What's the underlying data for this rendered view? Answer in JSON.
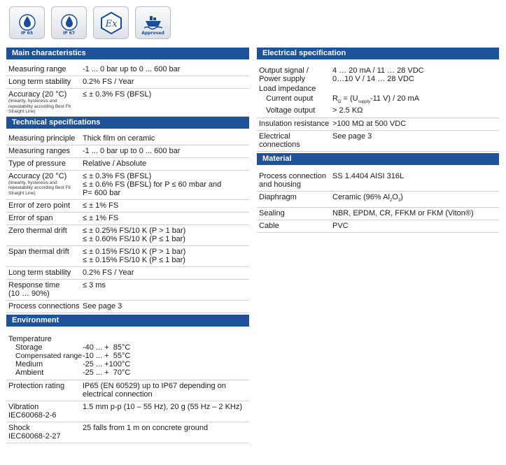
{
  "badges": [
    {
      "label": "IP 65",
      "icon": "water-drop-icon"
    },
    {
      "label": "IP 67",
      "icon": "water-drop-icon"
    },
    {
      "label": "Ex",
      "icon": "ex-hexagon-icon"
    },
    {
      "label": "Approved",
      "icon": "ship-icon"
    }
  ],
  "main_characteristics": {
    "title": "Main characteristics",
    "rows": [
      {
        "label": "Measuring range",
        "value": "-1 ... 0 bar up to 0 ... 600 bar"
      },
      {
        "label": "Long term stability",
        "value": "0.2% FS / Year"
      },
      {
        "label": "Accuracy (20 °C)",
        "note": "(linearity, hysteresis and repeatability according Best Fit Straight Line)",
        "value": "≤ ± 0.3% FS (BFSL)"
      }
    ]
  },
  "technical_specifications": {
    "title": "Technical specifications",
    "rows": [
      {
        "label": "Measuring principle",
        "value": "Thick film on ceramic"
      },
      {
        "label": "Measuring ranges",
        "value": "-1 ... 0 bar up to 0 ... 600 bar"
      },
      {
        "label": "Type of pressure",
        "value": "Relative / Absolute"
      },
      {
        "label": "Accuracy (20 °C)",
        "note": "(linearity, hysteresis and repeatability according Best Fit Straight Line)",
        "value_lines": [
          "≤ ± 0.3% FS (BFSL)",
          "≤ ± 0.6% FS (BFSL) for P ≤ 60 mbar and",
          "P= 600 bar"
        ]
      },
      {
        "label": "Error of zero point",
        "value": "≤ ± 1% FS"
      },
      {
        "label": "Error of span",
        "value": "≤ ± 1% FS"
      },
      {
        "label": "Zero thermal drift",
        "value_lines": [
          "≤ ± 0.25% FS/10 K (P > 1 bar)",
          "≤ ± 0.60% FS/10 K (P ≤ 1 bar)"
        ]
      },
      {
        "label": "Span thermal drift",
        "value_lines": [
          "≤ ± 0.15% FS/10 K (P > 1 bar)",
          "≤ ± 0.15% FS/10 K (P ≤ 1 bar)"
        ]
      },
      {
        "label": "Long term stability",
        "value": "0.2% FS / Year"
      },
      {
        "label_lines": [
          "Response time",
          "(10 … 90%)"
        ],
        "value": "≤ 3 ms"
      },
      {
        "label": "Process connections",
        "value": "See page 3"
      }
    ]
  },
  "environment": {
    "title": "Environment",
    "temperature_label": "Temperature",
    "temperature_rows": [
      {
        "label": "Storage",
        "value": "-40 ... +  85°C"
      },
      {
        "label": "Compensated range",
        "value": "-10 ... +  55°C"
      },
      {
        "label": "Medium",
        "value": "-25 ... +100°C"
      },
      {
        "label": "Ambient",
        "value": "-25 ... +  70°C"
      }
    ],
    "rows": [
      {
        "label": "Protection rating",
        "value_lines": [
          "IP65 (EN 60529) up to IP67 depending on",
          "electrical connection"
        ]
      },
      {
        "label_lines": [
          "Vibration",
          "IEC60068-2-6"
        ],
        "value": "1.5 mm p-p (10 – 55 Hz), 20 g (55 Hz – 2 KHz)"
      },
      {
        "label_lines": [
          "Shock",
          "IEC60068-2-27"
        ],
        "value": "25 falls from 1 m on concrete ground"
      }
    ]
  },
  "electrical_specification": {
    "title": "Electrical specification",
    "output_label_1": "Output signal /",
    "output_label_2": "Power supply",
    "output_value_1": "4 … 20 mA / 11 … 28 VDC",
    "output_value_2": "0…10 V / 14 … 28 VDC",
    "load_impedance": "Load impedance",
    "current_output_label": "Current ouput",
    "current_output_value_a": "R",
    "current_output_value_sub": "Ω",
    "current_output_value_b": " = (U",
    "current_output_value_sub2": "supply",
    "current_output_value_c": "-11 V) / 20 mA",
    "voltage_output_label": "Voltage output",
    "voltage_output_value": "> 2.5 KΩ",
    "rows": [
      {
        "label": "Insulation resistance",
        "value": ">100 MΩ at 500 VDC"
      },
      {
        "label": "Electrical connections",
        "value": "See page 3"
      }
    ]
  },
  "material": {
    "title": "Material",
    "process_label_1": "Process connection",
    "process_label_2": "and housing",
    "process_value": "SS 1.4404 AISI 316L",
    "diaphragm_label": "Diaphragm",
    "diaphragm_value_a": "Ceramic (96% Al",
    "diaphragm_value_sub1": "2",
    "diaphragm_value_b": "O",
    "diaphragm_value_sub2": "3",
    "diaphragm_value_c": ")",
    "sealing_label": "Sealing",
    "sealing_value": "NBR, EPDM, CR, FFKM or FKM (Viton®)",
    "cable_label": "Cable",
    "cable_value": "PVC"
  },
  "colors": {
    "header_bg": "#1d5299",
    "badge_icon": "#1a4c9c"
  }
}
